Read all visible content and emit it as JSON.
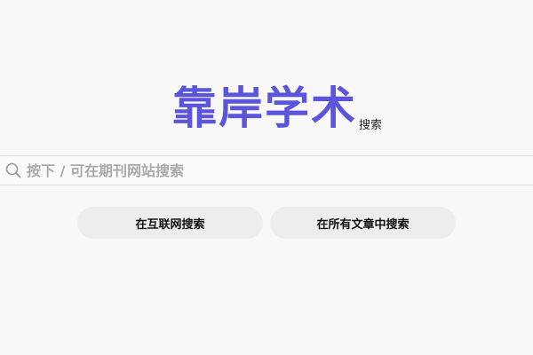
{
  "logo": {
    "title": "靠岸学术",
    "subtitle": "搜索"
  },
  "search": {
    "placeholder": "按下 / 可在期刊网站搜索",
    "value": "",
    "icon": "search-icon"
  },
  "actions": {
    "internet_search_label": "在互联网搜索",
    "articles_search_label": "在所有文章中搜索"
  },
  "colors": {
    "brand": "#5b55dc",
    "background": "#f8f8f8",
    "button_bg": "#ededed"
  }
}
